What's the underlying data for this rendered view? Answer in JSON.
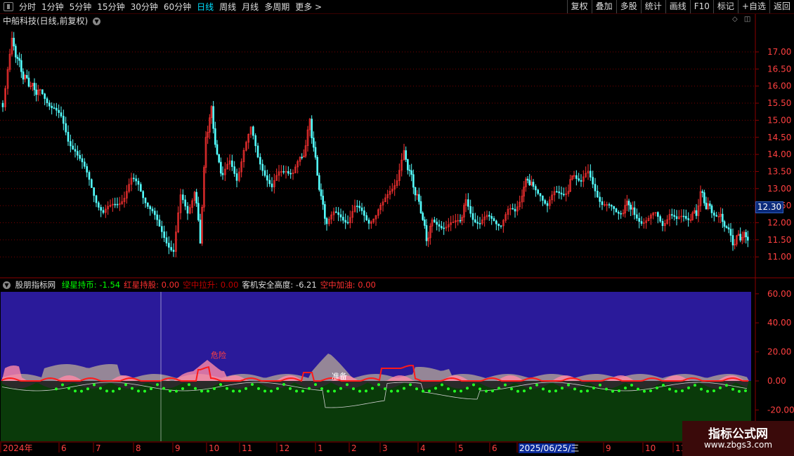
{
  "toolbar": {
    "periods": [
      "分时",
      "1分钟",
      "5分钟",
      "15分钟",
      "30分钟",
      "60分钟",
      "日线",
      "周线",
      "月线",
      "多周期",
      "更多"
    ],
    "active_period": "日线",
    "more_arrow": ">",
    "right_buttons": [
      "复权",
      "叠加",
      "多股",
      "统计",
      "画线",
      "F10",
      "标记",
      "+自选",
      "返回"
    ]
  },
  "main_chart": {
    "title": "中船科技(日线,前复权)",
    "current_price_tag": "12.30",
    "price_axis": [
      "17.00",
      "16.50",
      "16.00",
      "15.50",
      "15.00",
      "14.50",
      "14.00",
      "13.50",
      "13.00",
      "12.50",
      "12.00",
      "11.50",
      "11.00"
    ]
  },
  "sub_chart": {
    "indicator_name": "股朋指标网",
    "legend": [
      {
        "label": "绿星持币:",
        "value": "-1.54",
        "color": "#00ff00"
      },
      {
        "label": "红星持股:",
        "value": "0.00",
        "color": "#ff3030"
      },
      {
        "label": "空中拉升:",
        "value": "0.00",
        "color": "#c00000"
      },
      {
        "label": "客机安全高度:",
        "value": "-6.21",
        "color": "#dddddd"
      },
      {
        "label": "空中加油:",
        "value": "0.00",
        "color": "#ff3030"
      }
    ],
    "axis": [
      "60.00",
      "40.00",
      "20.00",
      "0.00",
      "-20.00"
    ],
    "annotations": [
      "危险",
      "准备"
    ]
  },
  "time_axis": {
    "labels": [
      "2024年",
      "6",
      "7",
      "8",
      "9",
      "10",
      "11",
      "12",
      "1",
      "2",
      "3",
      "4",
      "5",
      "6",
      "2025/06/25/三",
      "9",
      "10",
      "11"
    ]
  },
  "watermark": {
    "line1": "指标公式网",
    "line2": "www.zbgs3.com"
  },
  "colors": {
    "up": "#ff3232",
    "down": "#54ffff",
    "grid": "#8b0000",
    "sub_bg_top": "#2a1a9a",
    "sub_bg_bottom": "#0a3a0a"
  }
}
